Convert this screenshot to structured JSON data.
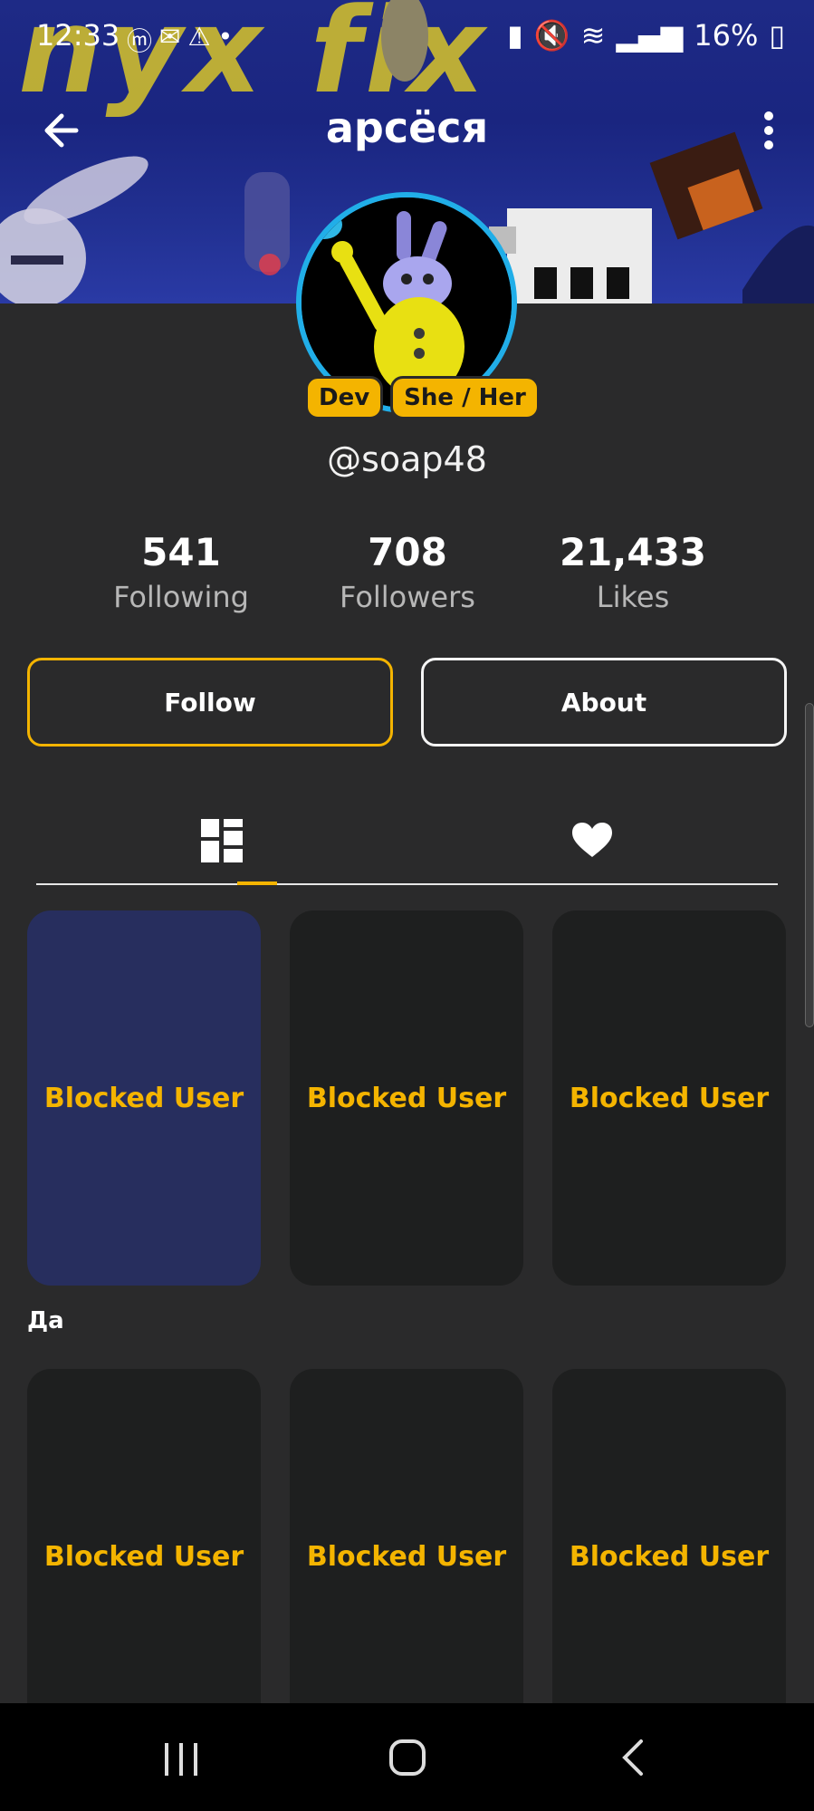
{
  "status_bar": {
    "time": "12:33",
    "battery": "16%"
  },
  "header": {
    "title": "арсёся"
  },
  "profile": {
    "badges": [
      "Dev",
      "She / Her"
    ],
    "username": "@soap48"
  },
  "stats": [
    {
      "value": "541",
      "label": "Following"
    },
    {
      "value": "708",
      "label": "Followers"
    },
    {
      "value": "21,433",
      "label": "Likes"
    }
  ],
  "actions": {
    "follow_label": "Follow",
    "about_label": "About"
  },
  "tabs": [
    {
      "icon": "grid-icon",
      "selected": true
    },
    {
      "icon": "heart-icon",
      "selected": false
    }
  ],
  "posts": [
    {
      "label": "Blocked User",
      "caption": "Да"
    },
    {
      "label": "Blocked User"
    },
    {
      "label": "Blocked User"
    },
    {
      "label": "Blocked User"
    },
    {
      "label": "Blocked User"
    },
    {
      "label": "Blocked User"
    }
  ],
  "colors": {
    "accent": "#f4b400",
    "background": "#2a2a2b",
    "card": "#1e1f1f",
    "card_highlight": "#272e5e",
    "avatar_ring": "#21aee8"
  }
}
